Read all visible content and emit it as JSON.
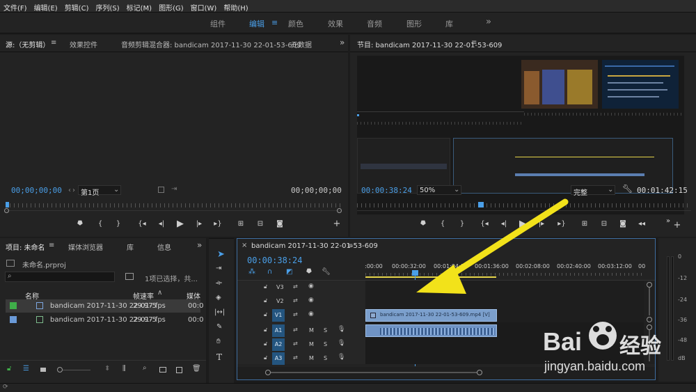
{
  "menu": [
    "文件(F)",
    "编辑(E)",
    "剪辑(C)",
    "序列(S)",
    "标记(M)",
    "图形(G)",
    "窗口(W)",
    "帮助(H)"
  ],
  "workspace_tabs": [
    "组件",
    "编辑",
    "颜色",
    "效果",
    "音频",
    "图形",
    "库"
  ],
  "workspace_active": "编辑",
  "more_glyph": "»",
  "source": {
    "tab": "源:（无剪辑）",
    "tabs": [
      "效果控件",
      "音频剪辑混合器: bandicam 2017-11-30 22-01-53-609",
      "元数据"
    ],
    "tc_left": "00;00;00;00",
    "page": "第1页",
    "tc_right": "00;00;00;00"
  },
  "program": {
    "title": "节目: bandicam 2017-11-30 22-01-53-609",
    "tc": "00:00:38:24",
    "zoom": "50%",
    "quality": "完整",
    "duration": "00:01:42:15"
  },
  "project": {
    "tabs": [
      "项目: 未命名",
      "媒体浏览器",
      "库",
      "信息"
    ],
    "file": "未命名.prproj",
    "selection": "1项已选择，共...",
    "col_name": "名称",
    "col_rate": "帧速率",
    "col_media": "媒体",
    "rows": [
      {
        "name": "bandicam 2017-11-30 22-01-5",
        "rate": "29.97 fps",
        "media": "00:0",
        "color": "#3fae49"
      },
      {
        "name": "bandicam 2017-11-30 22-01-5",
        "rate": "29.97 fps",
        "media": "00:0",
        "color": "#6a9ad8"
      }
    ]
  },
  "timeline": {
    "title": "bandicam 2017-11-30 22-01-53-609",
    "tc": "00:00:38:24",
    "ruler": [
      ":00:00",
      "00:00:32:00",
      "00:01:04:00",
      "00:01:36:00",
      "00:02:08:00",
      "00:02:40:00",
      "00:03:12:00",
      "00"
    ],
    "video_tracks": [
      "V3",
      "V2",
      "V1"
    ],
    "audio_tracks": [
      "A1",
      "A2",
      "A3"
    ],
    "clip_label": "bandicam 2017-11-30 22-01-53-609.mp4 [V]",
    "M": "M",
    "S": "S"
  },
  "meter": [
    "0",
    "-12",
    "-24",
    "-36",
    "-48",
    "dB"
  ],
  "watermark": {
    "brand": "Bai",
    "brand2": "经验",
    "url": "jingyan.baidu.com"
  },
  "colors": {
    "accent": "#4a9fe8",
    "arrow": "#f2e21a",
    "clip": "#7b9fcc"
  }
}
